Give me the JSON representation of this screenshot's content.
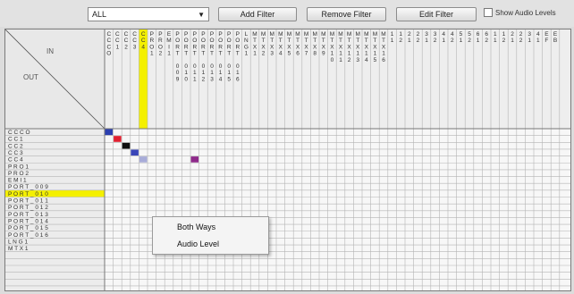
{
  "toolbar": {
    "filter_value": "ALL",
    "add_filter": "Add Filter",
    "remove_filter": "Remove Filter",
    "edit_filter": "Edit Filter",
    "show_audio_levels": "Show Audio Levels",
    "show_audio_levels_checked": false
  },
  "matrix": {
    "corner_in": "IN",
    "corner_out": "OUT",
    "columns": [
      {
        "lines": [
          "C",
          "C",
          "C",
          "O"
        ],
        "highlight": false
      },
      {
        "lines": [
          "C",
          "C",
          "1"
        ],
        "highlight": false
      },
      {
        "lines": [
          "C",
          "C",
          "2"
        ],
        "highlight": false
      },
      {
        "lines": [
          "C",
          "C",
          "3"
        ],
        "highlight": false
      },
      {
        "lines": [
          "C",
          "C",
          "4"
        ],
        "highlight": true
      },
      {
        "lines": [
          "P",
          "R",
          "O",
          "1"
        ],
        "highlight": false
      },
      {
        "lines": [
          "P",
          "R",
          "O",
          "2"
        ],
        "highlight": false
      },
      {
        "lines": [
          "E",
          "M",
          "I",
          "1"
        ],
        "highlight": false
      },
      {
        "lines": [
          "P",
          "O",
          "R",
          "T",
          "",
          "0",
          "0",
          "9"
        ],
        "highlight": false
      },
      {
        "lines": [
          "P",
          "O",
          "R",
          "T",
          "",
          "0",
          "1",
          "0"
        ],
        "highlight": false
      },
      {
        "lines": [
          "P",
          "O",
          "R",
          "T",
          "",
          "0",
          "1",
          "1"
        ],
        "highlight": false
      },
      {
        "lines": [
          "P",
          "O",
          "R",
          "T",
          "",
          "0",
          "1",
          "2"
        ],
        "highlight": false
      },
      {
        "lines": [
          "P",
          "O",
          "R",
          "T",
          "",
          "0",
          "1",
          "3"
        ],
        "highlight": false
      },
      {
        "lines": [
          "P",
          "O",
          "R",
          "T",
          "",
          "0",
          "1",
          "4"
        ],
        "highlight": false
      },
      {
        "lines": [
          "P",
          "O",
          "R",
          "T",
          "",
          "0",
          "1",
          "5"
        ],
        "highlight": false
      },
      {
        "lines": [
          "P",
          "O",
          "R",
          "T",
          "",
          "0",
          "1",
          "6"
        ],
        "highlight": false
      },
      {
        "lines": [
          "L",
          "N",
          "G",
          "1"
        ],
        "highlight": false
      },
      {
        "lines": [
          "M",
          "T",
          "X",
          "1"
        ],
        "highlight": false
      },
      {
        "lines": [
          "M",
          "T",
          "X",
          "2"
        ],
        "highlight": false
      },
      {
        "lines": [
          "M",
          "T",
          "X",
          "3"
        ],
        "highlight": false
      },
      {
        "lines": [
          "M",
          "T",
          "X",
          "4"
        ],
        "highlight": false
      },
      {
        "lines": [
          "M",
          "T",
          "X",
          "5"
        ],
        "highlight": false
      },
      {
        "lines": [
          "M",
          "T",
          "X",
          "6"
        ],
        "highlight": false
      },
      {
        "lines": [
          "M",
          "T",
          "X",
          "7"
        ],
        "highlight": false
      },
      {
        "lines": [
          "M",
          "T",
          "X",
          "8"
        ],
        "highlight": false
      },
      {
        "lines": [
          "M",
          "T",
          "X",
          "9"
        ],
        "highlight": false
      },
      {
        "lines": [
          "M",
          "T",
          "X",
          "1",
          "0"
        ],
        "highlight": false
      },
      {
        "lines": [
          "M",
          "T",
          "X",
          "1",
          "1"
        ],
        "highlight": false
      },
      {
        "lines": [
          "M",
          "T",
          "X",
          "1",
          "2"
        ],
        "highlight": false
      },
      {
        "lines": [
          "M",
          "T",
          "X",
          "1",
          "3"
        ],
        "highlight": false
      },
      {
        "lines": [
          "M",
          "T",
          "X",
          "1",
          "4"
        ],
        "highlight": false
      },
      {
        "lines": [
          "M",
          "T",
          "X",
          "1",
          "5"
        ],
        "highlight": false
      },
      {
        "lines": [
          "M",
          "T",
          "X",
          "1",
          "6"
        ],
        "highlight": false
      },
      {
        "lines": [
          "1",
          "1"
        ],
        "highlight": false
      },
      {
        "lines": [
          "1",
          "2"
        ],
        "highlight": false
      },
      {
        "lines": [
          "2",
          "1"
        ],
        "highlight": false
      },
      {
        "lines": [
          "2",
          "2"
        ],
        "highlight": false
      },
      {
        "lines": [
          "3",
          "1"
        ],
        "highlight": false
      },
      {
        "lines": [
          "3",
          "2"
        ],
        "highlight": false
      },
      {
        "lines": [
          "4",
          "1"
        ],
        "highlight": false
      },
      {
        "lines": [
          "4",
          "2"
        ],
        "highlight": false
      },
      {
        "lines": [
          "5",
          "1"
        ],
        "highlight": false
      },
      {
        "lines": [
          "5",
          "2"
        ],
        "highlight": false
      },
      {
        "lines": [
          "6",
          "1"
        ],
        "highlight": false
      },
      {
        "lines": [
          "6",
          "2"
        ],
        "highlight": false
      },
      {
        "lines": [
          "1",
          "1"
        ],
        "highlight": false
      },
      {
        "lines": [
          "1",
          "2"
        ],
        "highlight": false
      },
      {
        "lines": [
          "2",
          "1"
        ],
        "highlight": false
      },
      {
        "lines": [
          "2",
          "2"
        ],
        "highlight": false
      },
      {
        "lines": [
          "3",
          "1"
        ],
        "highlight": false
      },
      {
        "lines": [
          "4",
          "1"
        ],
        "highlight": false
      },
      {
        "lines": [
          "E",
          "F"
        ],
        "highlight": false
      },
      {
        "lines": [
          "E",
          "B"
        ],
        "highlight": false
      }
    ],
    "rows": [
      {
        "label": "C C C O",
        "highlight": false
      },
      {
        "label": "C C  1",
        "highlight": false
      },
      {
        "label": "C C  2",
        "highlight": false
      },
      {
        "label": "C C  3",
        "highlight": false
      },
      {
        "label": "C C  4",
        "highlight": false
      },
      {
        "label": "P R O 1",
        "highlight": false
      },
      {
        "label": "P R O 2",
        "highlight": false
      },
      {
        "label": "E M I  1",
        "highlight": false
      },
      {
        "label": "P O R T _ 0 0 9",
        "highlight": false
      },
      {
        "label": "P O R T _ 0 1 0",
        "highlight": true
      },
      {
        "label": "P O R T _ 0 1 1",
        "highlight": false
      },
      {
        "label": "P O R T _ 0 1 2",
        "highlight": false
      },
      {
        "label": "P O R T _ 0 1 3",
        "highlight": false
      },
      {
        "label": "P O R T _ 0 1 4",
        "highlight": false
      },
      {
        "label": "P O R T _ 0 1 5",
        "highlight": false
      },
      {
        "label": "P O R T _ 0 1 6",
        "highlight": false
      },
      {
        "label": "L N G 1",
        "highlight": false
      },
      {
        "label": "M T X 1",
        "highlight": false
      }
    ],
    "crosspoints": [
      {
        "row": 0,
        "col": 0,
        "color": "#2b3fb0"
      },
      {
        "row": 1,
        "col": 1,
        "color": "#e02030"
      },
      {
        "row": 2,
        "col": 2,
        "color": "#111111"
      },
      {
        "row": 3,
        "col": 3,
        "color": "#3a46b8"
      },
      {
        "row": 4,
        "col": 4,
        "color": "#a8acd8"
      },
      {
        "row": 4,
        "col": 10,
        "color": "#8e2a8a"
      }
    ],
    "highlight_color": "#f4f000"
  },
  "context_menu": {
    "items": [
      "Both Ways",
      "Audio Level"
    ]
  }
}
